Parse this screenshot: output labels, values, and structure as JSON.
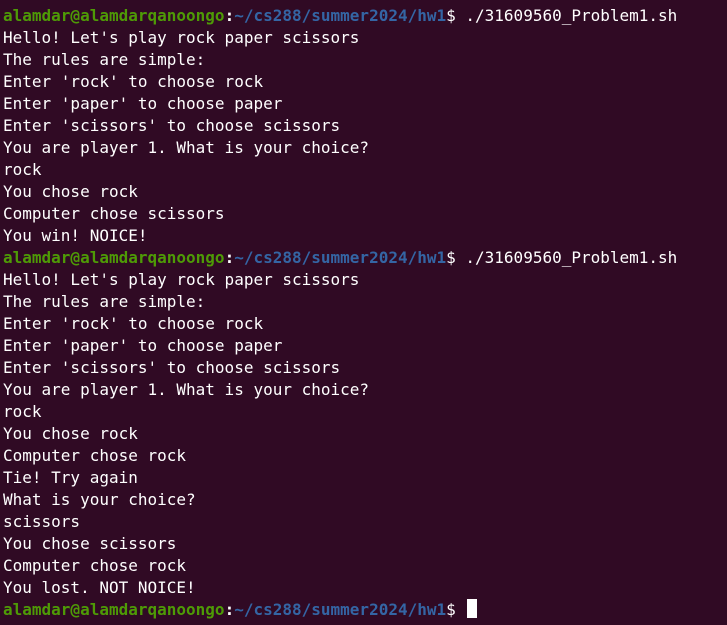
{
  "terminal": {
    "background": "#300a24",
    "user_color": "#4e9a06",
    "path_color": "#3465a4",
    "prompt_user": "alamdar@alamdarqanoongo",
    "prompt_colon": ":",
    "prompt_path": "~/cs288/summer2024/hw1",
    "prompt_symbol": "$ ",
    "command": "./31609560_Problem1.sh",
    "session1": [
      "Hello! Let's play rock paper scissors",
      "The rules are simple:",
      "Enter 'rock' to choose rock",
      "Enter 'paper' to choose paper",
      "Enter 'scissors' to choose scissors",
      "You are player 1. What is your choice?",
      "rock",
      "You chose rock",
      "Computer chose scissors",
      "You win! NOICE!"
    ],
    "session2": [
      "Hello! Let's play rock paper scissors",
      "The rules are simple:",
      "Enter 'rock' to choose rock",
      "Enter 'paper' to choose paper",
      "Enter 'scissors' to choose scissors",
      "You are player 1. What is your choice?",
      "rock",
      "You chose rock",
      "Computer chose rock",
      "Tie! Try again",
      "What is your choice?",
      "scissors",
      "You chose scissors",
      "Computer chose rock",
      "You lost. NOT NOICE!"
    ]
  }
}
